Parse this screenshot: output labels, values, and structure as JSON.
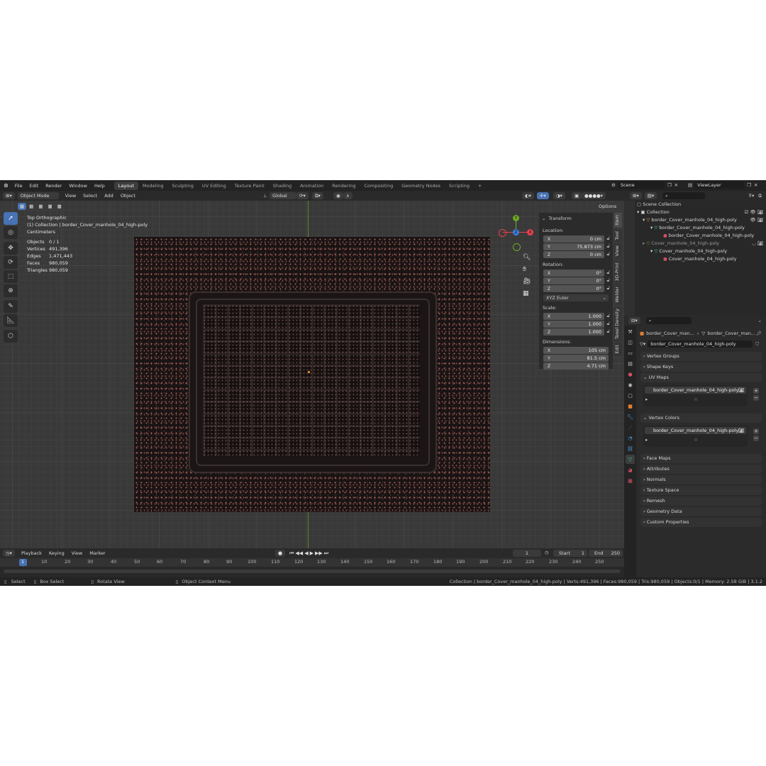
{
  "topbar": {
    "menus": [
      "File",
      "Edit",
      "Render",
      "Window",
      "Help"
    ],
    "workspaces": [
      "Layout",
      "Modeling",
      "Sculpting",
      "UV Editing",
      "Texture Paint",
      "Shading",
      "Animation",
      "Rendering",
      "Compositing",
      "Geometry Nodes",
      "Scripting"
    ],
    "active_workspace": "Layout",
    "add_tab": "+",
    "scene": "Scene",
    "view_layer": "ViewLayer"
  },
  "header": {
    "mode": "Object Mode",
    "menus": [
      "View",
      "Select",
      "Add",
      "Object"
    ],
    "orientation": "Global",
    "options": "Options"
  },
  "viewport": {
    "view_name": "Top Orthographic",
    "collection_line": "(1) Collection | border_Cover_manhole_04_high-poly",
    "units": "Centimeters",
    "stats": [
      {
        "label": "Objects",
        "value": "0 / 1"
      },
      {
        "label": "Vertices",
        "value": "491,396"
      },
      {
        "label": "Edges",
        "value": "1,471,443"
      },
      {
        "label": "Faces",
        "value": "980,059"
      },
      {
        "label": "Triangles",
        "value": "980,059"
      }
    ],
    "gizmo": {
      "y": "Y",
      "x": "X",
      "z": "Z"
    }
  },
  "npanel": {
    "title": "Transform",
    "location_label": "Location:",
    "location": [
      {
        "axis": "X",
        "value": "0 cm"
      },
      {
        "axis": "Y",
        "value": "75.873 cm"
      },
      {
        "axis": "Z",
        "value": "0 cm"
      }
    ],
    "rotation_label": "Rotation:",
    "rotation": [
      {
        "axis": "X",
        "value": "0°"
      },
      {
        "axis": "Y",
        "value": "0°"
      },
      {
        "axis": "Z",
        "value": "0°"
      }
    ],
    "rotation_mode": "XYZ Euler",
    "scale_label": "Scale:",
    "scale": [
      {
        "axis": "X",
        "value": "1.000"
      },
      {
        "axis": "Y",
        "value": "1.000"
      },
      {
        "axis": "Z",
        "value": "1.000"
      }
    ],
    "dimensions_label": "Dimensions:",
    "dimensions": [
      {
        "axis": "X",
        "value": "105 cm"
      },
      {
        "axis": "Y",
        "value": "81.5 cm"
      },
      {
        "axis": "Z",
        "value": "4.71 cm"
      }
    ],
    "tabs": [
      "Item",
      "Tool",
      "View",
      "3D-Print",
      "Welder",
      "Texel Density",
      "Edit"
    ]
  },
  "timeline": {
    "menus": [
      "Playback",
      "Keying",
      "View",
      "Marker"
    ],
    "current_frame": "1",
    "start_label": "Start",
    "start": "1",
    "end_label": "End",
    "end": "250",
    "ticks": [
      "1",
      "10",
      "20",
      "30",
      "40",
      "50",
      "60",
      "70",
      "80",
      "90",
      "100",
      "110",
      "120",
      "130",
      "140",
      "150",
      "160",
      "170",
      "180",
      "190",
      "200",
      "210",
      "220",
      "230",
      "240",
      "250"
    ]
  },
  "statusbar": {
    "select": "Select",
    "box_select": "Box Select",
    "rotate_view": "Rotate View",
    "context_menu": "Object Context Menu",
    "info": "Collection | border_Cover_manhole_04_high-poly | Verts:491,396 | Faces:980,059 | Tris:980,059 | Objects:0/1 | Memory: 2.58 GiB | 3.1.2"
  },
  "outliner": {
    "root": "Scene Collection",
    "collection": "Collection",
    "obj1": "border_Cover_manhole_04_high-poly",
    "obj1_mesh": "border_Cover_manhole_04_high-poly",
    "obj1_mat": "border_Cover_manhole_04_high-poly",
    "obj2": "Cover_manhole_04_high-poly",
    "obj2_mesh": "Cover_manhole_04_high-poly",
    "obj2_mat": "Cover_manhole_04_high-poly"
  },
  "properties": {
    "breadcrumb_obj": "border_Cover_man...",
    "breadcrumb_mesh": "border_Cover_man...",
    "data_name": "border_Cover_manhole_04_high-poly",
    "panels_top": [
      "Vertex Groups",
      "Shape Keys"
    ],
    "uv_maps": "UV Maps",
    "uv_item": "border_Cover_manhole_04_high-poly",
    "vertex_colors": "Vertex Colors",
    "vc_item": "border_Cover_manhole_04_high-poly",
    "panels_bottom": [
      "Face Maps",
      "Attributes",
      "Normals",
      "Texture Space",
      "Remesh",
      "Geometry Data",
      "Custom Properties"
    ],
    "plus": "+",
    "minus": "−"
  },
  "colors": {
    "accent": "#4772b3",
    "x_axis": "#e8424e",
    "y_axis": "#6ea924",
    "z_axis": "#3d7de0"
  }
}
